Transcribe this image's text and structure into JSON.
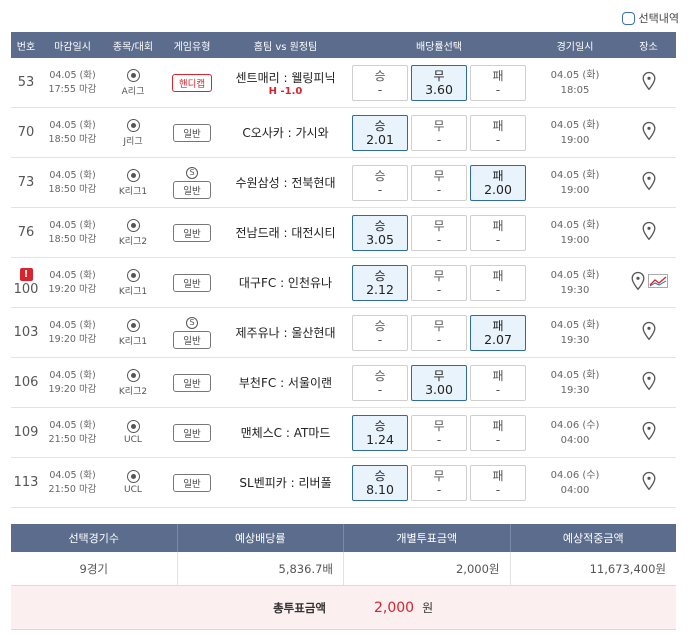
{
  "toggle_label": "선택내역",
  "headers": {
    "num": "번호",
    "deadline": "마감일시",
    "sport": "종목/대회",
    "game_type": "게임유형",
    "teams": "홈팀 vs 원정팀",
    "odds": "배당률선택",
    "game_time": "경기일시",
    "place": "장소"
  },
  "rows": [
    {
      "num": "53",
      "date": "04.05 (화)",
      "close": "17:55 마감",
      "league": "A리그",
      "special": false,
      "type": "핸디캡",
      "type_red": true,
      "teams": "센트매리 : 웰링피닉",
      "handicap": "H -1.0",
      "odds": [
        {
          "label": "승",
          "value": "-",
          "sel": false
        },
        {
          "label": "무",
          "value": "3.60",
          "sel": true
        },
        {
          "label": "패",
          "value": "-",
          "sel": false
        }
      ],
      "gdate": "04.05 (화)",
      "gtime": "18:05",
      "alert": false,
      "trend": false
    },
    {
      "num": "70",
      "date": "04.05 (화)",
      "close": "18:50 마감",
      "league": "J리그",
      "special": false,
      "type": "일반",
      "type_red": false,
      "teams": "C오사카 : 가시와",
      "handicap": "",
      "odds": [
        {
          "label": "승",
          "value": "2.01",
          "sel": true
        },
        {
          "label": "무",
          "value": "-",
          "sel": false
        },
        {
          "label": "패",
          "value": "-",
          "sel": false
        }
      ],
      "gdate": "04.05 (화)",
      "gtime": "19:00",
      "alert": false,
      "trend": false
    },
    {
      "num": "73",
      "date": "04.05 (화)",
      "close": "18:50 마감",
      "league": "K리그1",
      "special": true,
      "type": "일반",
      "type_red": false,
      "teams": "수원삼성 : 전북현대",
      "handicap": "",
      "odds": [
        {
          "label": "승",
          "value": "-",
          "sel": false
        },
        {
          "label": "무",
          "value": "-",
          "sel": false
        },
        {
          "label": "패",
          "value": "2.00",
          "sel": true
        }
      ],
      "gdate": "04.05 (화)",
      "gtime": "19:00",
      "alert": false,
      "trend": false
    },
    {
      "num": "76",
      "date": "04.05 (화)",
      "close": "18:50 마감",
      "league": "K리그2",
      "special": false,
      "type": "일반",
      "type_red": false,
      "teams": "전남드래 : 대전시티",
      "handicap": "",
      "odds": [
        {
          "label": "승",
          "value": "3.05",
          "sel": true
        },
        {
          "label": "무",
          "value": "-",
          "sel": false
        },
        {
          "label": "패",
          "value": "-",
          "sel": false
        }
      ],
      "gdate": "04.05 (화)",
      "gtime": "19:00",
      "alert": false,
      "trend": false
    },
    {
      "num": "100",
      "date": "04.05 (화)",
      "close": "19:20 마감",
      "league": "K리그1",
      "special": false,
      "type": "일반",
      "type_red": false,
      "teams": "대구FC : 인천유나",
      "handicap": "",
      "odds": [
        {
          "label": "승",
          "value": "2.12",
          "sel": true
        },
        {
          "label": "무",
          "value": "-",
          "sel": false
        },
        {
          "label": "패",
          "value": "-",
          "sel": false
        }
      ],
      "gdate": "04.05 (화)",
      "gtime": "19:30",
      "alert": true,
      "alert_text": "!",
      "trend": true
    },
    {
      "num": "103",
      "date": "04.05 (화)",
      "close": "19:20 마감",
      "league": "K리그1",
      "special": true,
      "type": "일반",
      "type_red": false,
      "teams": "제주유나 : 울산현대",
      "handicap": "",
      "odds": [
        {
          "label": "승",
          "value": "-",
          "sel": false
        },
        {
          "label": "무",
          "value": "-",
          "sel": false
        },
        {
          "label": "패",
          "value": "2.07",
          "sel": true
        }
      ],
      "gdate": "04.05 (화)",
      "gtime": "19:30",
      "alert": false,
      "trend": false
    },
    {
      "num": "106",
      "date": "04.05 (화)",
      "close": "19:20 마감",
      "league": "K리그2",
      "special": false,
      "type": "일반",
      "type_red": false,
      "teams": "부천FC : 서울이랜",
      "handicap": "",
      "odds": [
        {
          "label": "승",
          "value": "-",
          "sel": false
        },
        {
          "label": "무",
          "value": "3.00",
          "sel": true
        },
        {
          "label": "패",
          "value": "-",
          "sel": false
        }
      ],
      "gdate": "04.05 (화)",
      "gtime": "19:30",
      "alert": false,
      "trend": false
    },
    {
      "num": "109",
      "date": "04.05 (화)",
      "close": "21:50 마감",
      "league": "UCL",
      "special": false,
      "type": "일반",
      "type_red": false,
      "teams": "맨체스C : AT마드",
      "handicap": "",
      "odds": [
        {
          "label": "승",
          "value": "1.24",
          "sel": true
        },
        {
          "label": "무",
          "value": "-",
          "sel": false
        },
        {
          "label": "패",
          "value": "-",
          "sel": false
        }
      ],
      "gdate": "04.06 (수)",
      "gtime": "04:00",
      "alert": false,
      "trend": false
    },
    {
      "num": "113",
      "date": "04.05 (화)",
      "close": "21:50 마감",
      "league": "UCL",
      "special": false,
      "type": "일반",
      "type_red": false,
      "teams": "SL벤피카 : 리버풀",
      "handicap": "",
      "odds": [
        {
          "label": "승",
          "value": "8.10",
          "sel": true
        },
        {
          "label": "무",
          "value": "-",
          "sel": false
        },
        {
          "label": "패",
          "value": "-",
          "sel": false
        }
      ],
      "gdate": "04.06 (수)",
      "gtime": "04:00",
      "alert": false,
      "trend": false
    }
  ],
  "special_mark": "S",
  "summary": {
    "headers": [
      "선택경기수",
      "예상배당률",
      "개별투표금액",
      "예상적중금액"
    ],
    "values": [
      "9경기",
      "5,836.7배",
      "2,000원",
      "11,673,400원"
    ],
    "total_label": "총투표금액",
    "total_amount": "2,000",
    "total_unit": "원"
  },
  "colors": {
    "header_bg": "#5b6c8c",
    "accent_red": "#d9232d",
    "selected_border": "#2f6aa8",
    "selected_bg": "#e9f3fb"
  }
}
